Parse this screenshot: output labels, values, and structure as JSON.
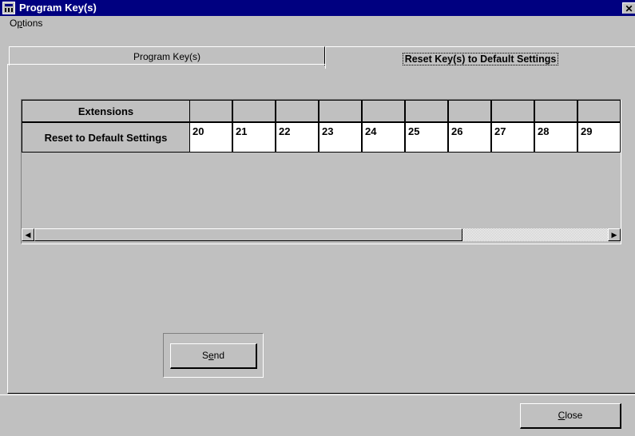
{
  "window": {
    "title": "Program Key(s)",
    "close_glyph": "✕"
  },
  "menu": {
    "options_prefix": "O",
    "options_mnemonic": "p",
    "options_suffix": "tions"
  },
  "tabs": [
    {
      "label": "Program Key(s)",
      "active": false
    },
    {
      "label": "Reset Key(s) to Default Settings",
      "active": true
    }
  ],
  "grid": {
    "row_headers": [
      "Extensions",
      "Reset to Default Settings"
    ],
    "extensions": [
      "",
      "",
      "",
      "",
      "",
      "",
      "",
      "",
      "",
      ""
    ],
    "values": [
      "20",
      "21",
      "22",
      "23",
      "24",
      "25",
      "26",
      "27",
      "28",
      "29"
    ]
  },
  "scrollbar": {
    "left_arrow": "◀",
    "right_arrow": "▶"
  },
  "buttons": {
    "send_prefix": "S",
    "send_mnemonic": "e",
    "send_suffix": "nd",
    "close_prefix": "",
    "close_mnemonic": "C",
    "close_suffix": "lose"
  }
}
